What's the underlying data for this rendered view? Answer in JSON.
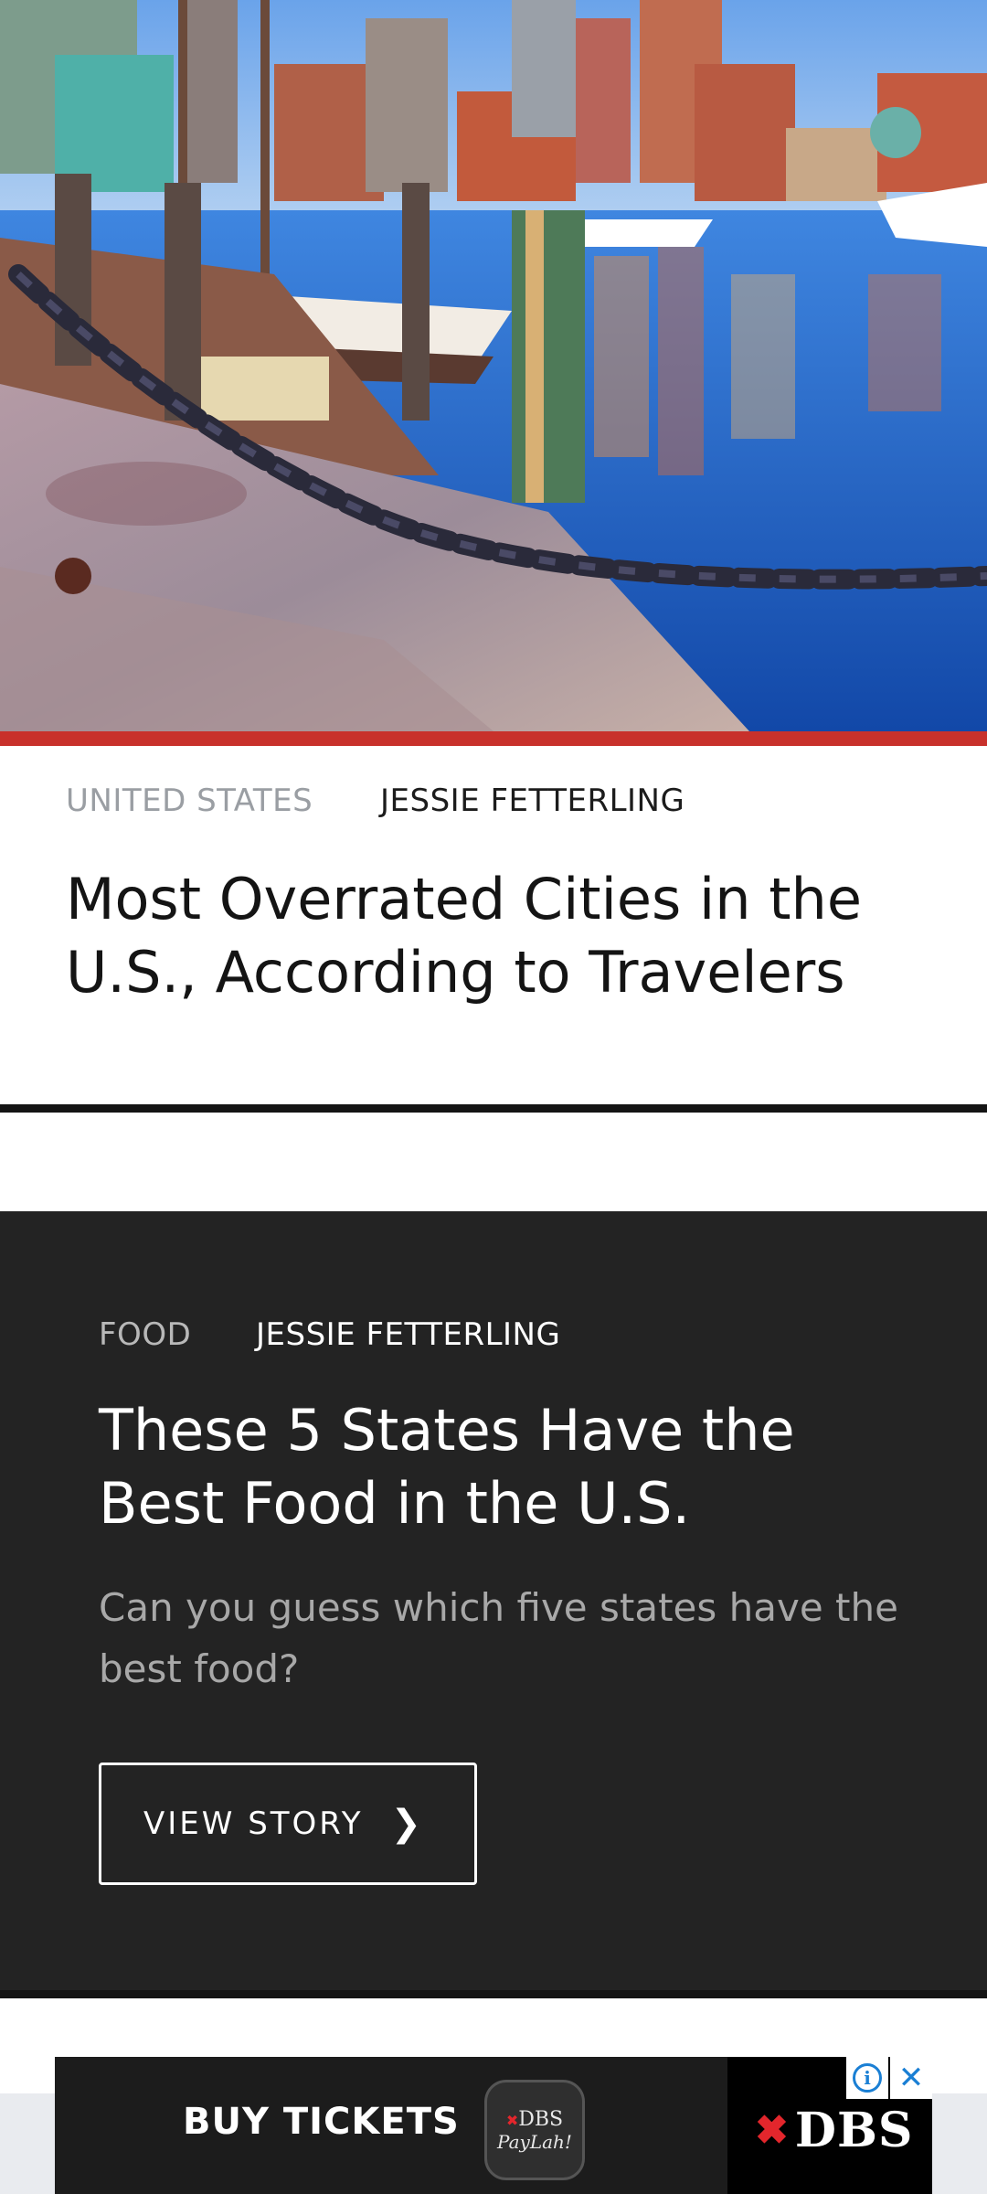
{
  "hero": {
    "icon": "harbor-photo"
  },
  "colors": {
    "accent_red": "#c8312b",
    "dark_card": "#232323",
    "ad_info_blue": "#1a7fd4"
  },
  "article1": {
    "category": "UNITED STATES",
    "author": "JESSIE FETTERLING",
    "title": "Most Overrated Cities in the U.S., According to Travelers"
  },
  "article2": {
    "category": "FOOD",
    "author": "JESSIE FETTERLING",
    "title": "These 5 States Have the Best Food in the U.S.",
    "description": "Can you guess which five states have the best food?",
    "button_label": "VIEW STORY",
    "button_icon": "chevron-right-icon"
  },
  "ad": {
    "cta": "BUY TICKETS",
    "paylah_line1": "DBS",
    "paylah_line2": "PayLah!",
    "brand": "DBS",
    "info_icon": "info-icon",
    "close_icon": "close-icon"
  }
}
